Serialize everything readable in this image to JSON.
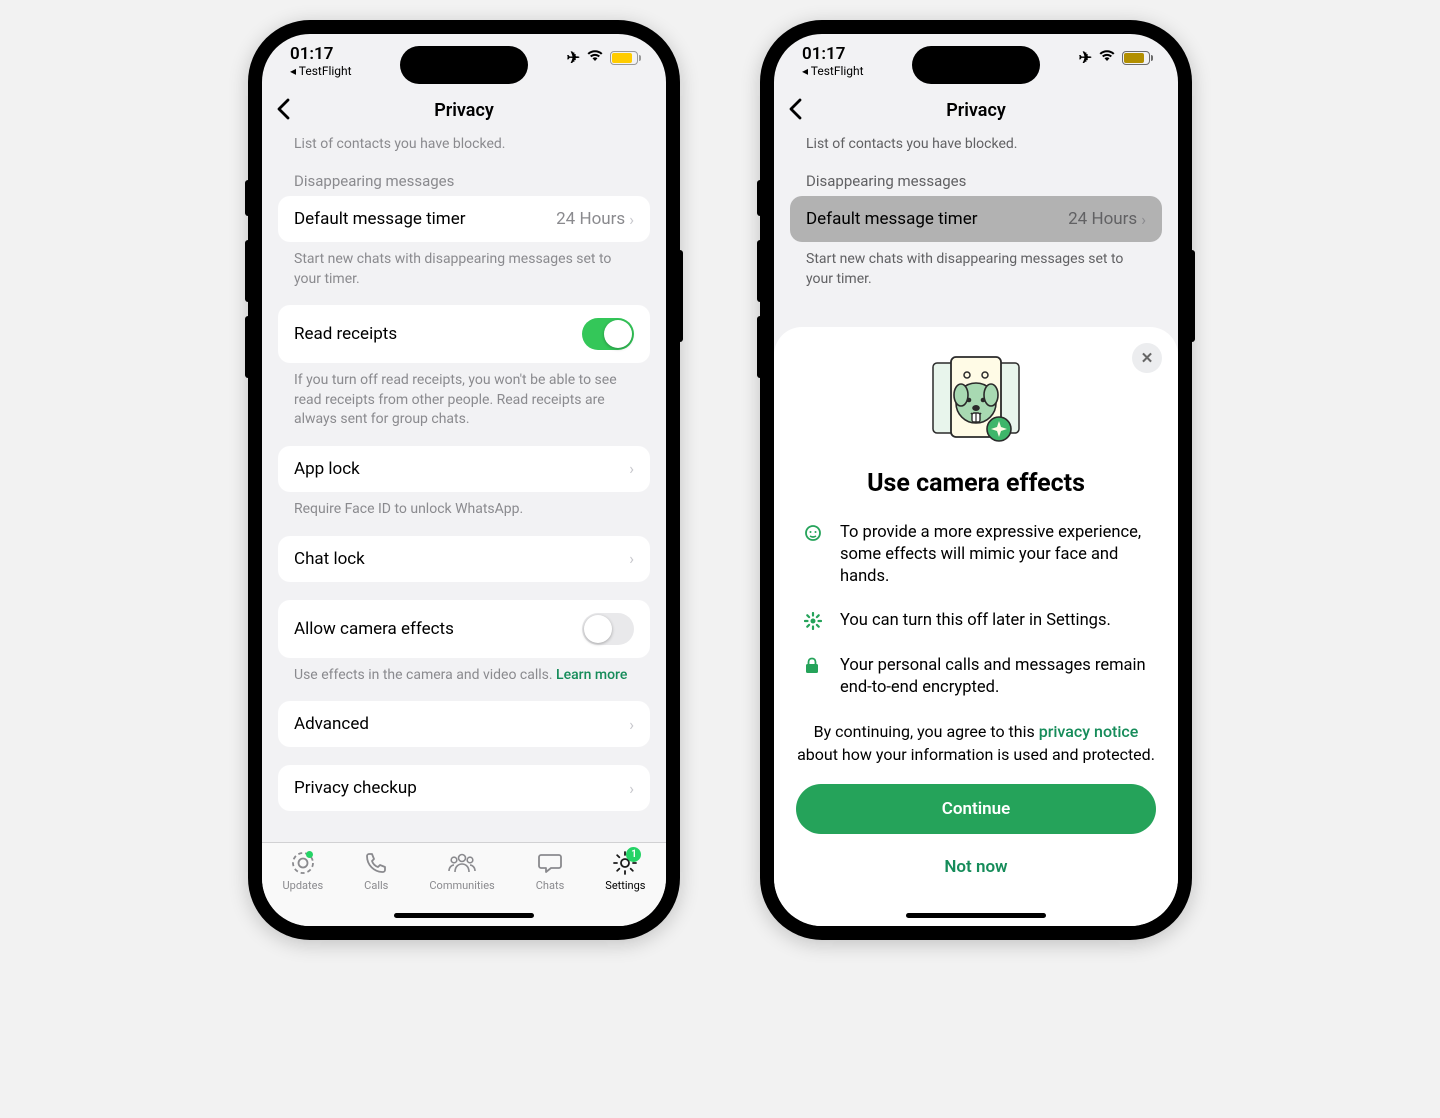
{
  "status": {
    "time": "01:17",
    "back_app": "◂ TestFlight"
  },
  "header": {
    "title": "Privacy"
  },
  "privacy": {
    "blocked_cut": "List of contacts you have blocked.",
    "disappearing_header": "Disappearing messages",
    "default_timer_label": "Default message timer",
    "default_timer_value": "24 Hours",
    "default_timer_footer": "Start new chats with disappearing messages set to your timer.",
    "read_receipts_label": "Read receipts",
    "read_receipts_footer": "If you turn off read receipts, you won't be able to see read receipts from other people. Read receipts are always sent for group chats.",
    "app_lock_label": "App lock",
    "app_lock_footer": "Require Face ID to unlock WhatsApp.",
    "chat_lock_label": "Chat lock",
    "camera_effects_label": "Allow camera effects",
    "camera_effects_footer_text": "Use effects in the camera and video calls. ",
    "learn_more": "Learn more",
    "advanced_label": "Advanced",
    "privacy_checkup_label": "Privacy checkup"
  },
  "tabs": {
    "updates": "Updates",
    "calls": "Calls",
    "communities": "Communities",
    "chats": "Chats",
    "settings": "Settings",
    "settings_badge": "1"
  },
  "sheet": {
    "title": "Use camera effects",
    "bullets": [
      "To provide a more expressive experience, some effects will mimic your face and hands.",
      "You can turn this off later in Settings.",
      "Your personal calls and messages remain end-to-end encrypted."
    ],
    "notice_pre": "By continuing, you agree to this ",
    "notice_link": "privacy notice",
    "notice_post": " about how your information is used and protected.",
    "continue": "Continue",
    "not_now": "Not now"
  }
}
